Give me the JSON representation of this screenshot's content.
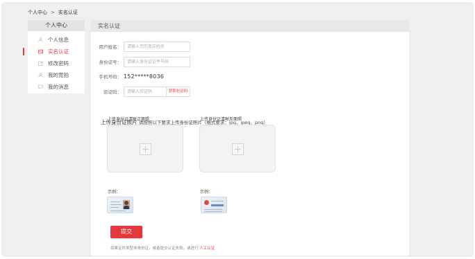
{
  "breadcrumb": {
    "home": "个人中心",
    "separator": ">",
    "current": "实名认证"
  },
  "sidebar": {
    "title": "个人中心",
    "items": [
      {
        "label": "个人信息",
        "icon": "user-icon",
        "active": false
      },
      {
        "label": "实名认证",
        "icon": "id-card-icon",
        "active": true
      },
      {
        "label": "修改密码",
        "icon": "edit-icon",
        "active": false
      },
      {
        "label": "我的竞拍",
        "icon": "auction-icon",
        "active": false
      },
      {
        "label": "我的消息",
        "icon": "message-icon",
        "active": false
      }
    ]
  },
  "main": {
    "title": "实名认证",
    "form": {
      "name_label": "用户姓名：",
      "name_placeholder": "请输入您的真实姓名",
      "id_label": "身份证号：",
      "id_placeholder": "请输入身份证证件号码",
      "phone_label": "手机号码：",
      "phone_value": "152*****8036",
      "code_label": "验证码：",
      "code_placeholder": "请输入验证码",
      "code_button": "获取验证码"
    },
    "upload": {
      "title": "上传身份证照片",
      "hint": "请按照以下要求上传身份证照片（格式要求：jpg、jpeg、png）",
      "front_label": "上传身份证清晰正面照",
      "back_label": "上传身份证清晰反面照",
      "sample_label": "示例："
    },
    "submit_label": "提交",
    "footer_text": "如果证件类型非身份证，或者提交认证失败，请进行",
    "footer_link": "人工认证"
  },
  "colors": {
    "accent": "#e4393c",
    "panel_bg": "#efefef",
    "header_bg": "#e8e8e8"
  }
}
